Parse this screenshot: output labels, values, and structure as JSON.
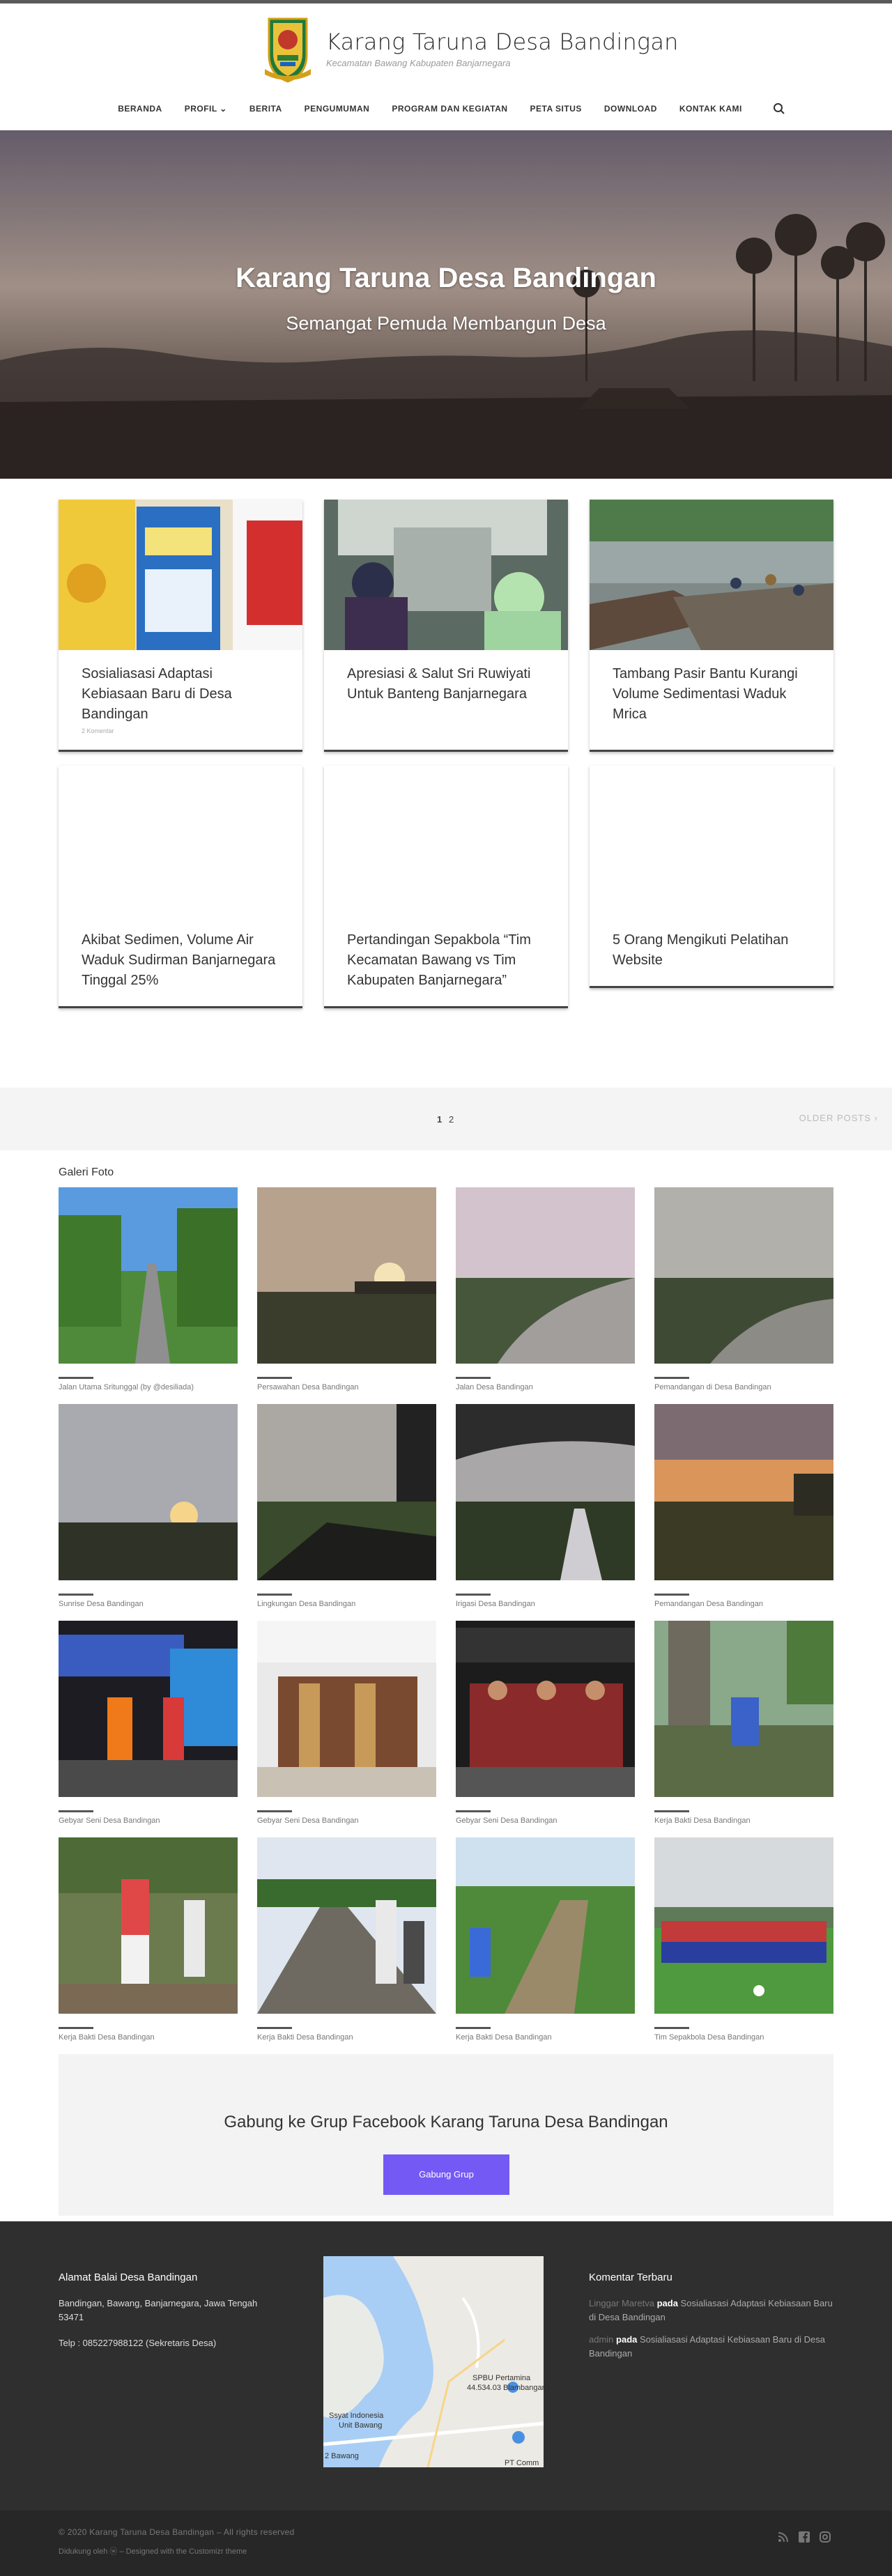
{
  "site": {
    "title": "Karang Taruna Desa Bandingan",
    "tagline": "Kecamatan Bawang Kabupaten Banjarnegara"
  },
  "nav": {
    "items": [
      "BERANDA",
      "PROFIL ⌄",
      "BERITA",
      "PENGUMUMAN",
      "PROGRAM DAN KEGIATAN",
      "PETA SITUS",
      "DOWNLOAD",
      "KONTAK KAMI"
    ],
    "search_icon": "search-icon"
  },
  "hero": {
    "title": "Karang Taruna Desa Bandingan",
    "subtitle": "Semangat Pemuda Membangun Desa"
  },
  "posts": [
    {
      "title": "Sosialiasasi Adaptasi Kebiasaan Baru di Desa Bandingan",
      "meta": "2 Komentar"
    },
    {
      "title": "Apresiasi & Salut Sri Ruwiyati Untuk Banteng Banjarnegara",
      "meta": ""
    },
    {
      "title": "Tambang Pasir Bantu Kurangi Volume Sedimentasi Waduk Mrica",
      "meta": ""
    },
    {
      "title": "Akibat Sedimen, Volume Air Waduk Sudirman Banjarnegara Tinggal 25%",
      "meta": ""
    },
    {
      "title": "Pertandingan Sepakbola “Tim Kecamatan Bawang vs Tim Kabupaten Banjarnegara”",
      "meta": ""
    },
    {
      "title": "5 Orang Mengikuti Pelatihan Website",
      "meta": ""
    }
  ],
  "pager": {
    "pages": [
      "1",
      "2"
    ],
    "older": "OLDER POSTS ›"
  },
  "gallery": {
    "title": "Galeri Foto",
    "captions": [
      "Jalan Utama Sritunggal (by @desiliada)",
      "Persawahan Desa Bandingan",
      "Jalan Desa Bandingan",
      "Pemandangan di Desa Bandingan",
      "Sunrise Desa Bandingan",
      "Lingkungan Desa Bandingan",
      "Irigasi Desa Bandingan",
      "Pemandangan Desa Bandingan",
      "Gebyar Seni Desa Bandingan",
      "Gebyar Seni Desa Bandingan",
      "Gebyar Seni Desa Bandingan",
      "Kerja Bakti Desa Bandingan",
      "Kerja Bakti Desa Bandingan",
      "Kerja Bakti Desa Bandingan",
      "Kerja Bakti Desa Bandingan",
      "Tim Sepakbola Desa Bandingan"
    ]
  },
  "facebook": {
    "title": "Gabung ke Grup Facebook Karang Taruna Desa Bandingan",
    "button": "Gabung Grup"
  },
  "footer": {
    "address_title": "Alamat Balai Desa Bandingan",
    "address": "Bandingan, Bawang, Banjarnegara, Jawa Tengah 53471",
    "phone": "Telp : 085227988122 (Sekretaris Desa)",
    "comments_title": "Komentar Terbaru",
    "comments": [
      {
        "author": "Linggar Maretva",
        "on": "pada",
        "post": "Sosialiasasi Adaptasi Kebiasaan Baru di Desa Bandingan"
      },
      {
        "author": "admin",
        "on": "pada",
        "post": "Sosialiasasi Adaptasi Kebiasaan Baru di Desa Bandingan"
      }
    ],
    "map_labels": [
      "SPBU Pertamina",
      "44.534.03 Blambangan",
      "Ssyat Indonesia",
      "Unit Bawang",
      "2 Bawang",
      "PT Comm"
    ]
  },
  "bottom": {
    "copyright": "© 2020 Karang Taruna Desa Bandingan – All rights reserved",
    "credit": "Didukung oleh ⓦ – Designed with the Customizr theme"
  }
}
